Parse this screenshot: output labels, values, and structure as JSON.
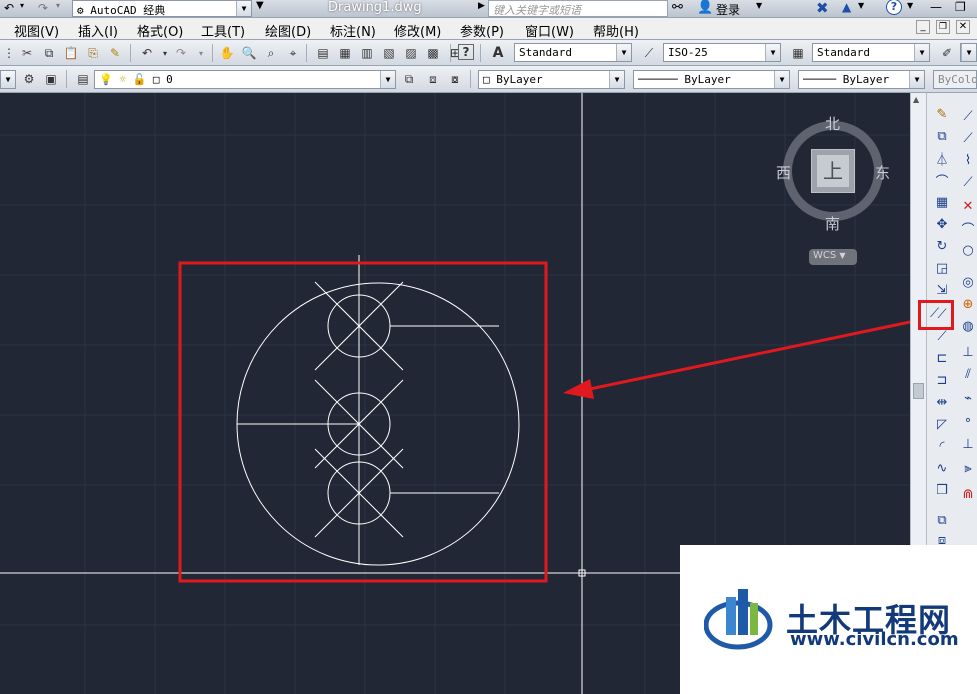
{
  "title_bar": {
    "workspace": "AutoCAD 经典",
    "document": "Drawing1.dwg",
    "search_placeholder": "键入关键字或短语",
    "login": "登录"
  },
  "menu": [
    "视图(V)",
    "插入(I)",
    "格式(O)",
    "工具(T)",
    "绘图(D)",
    "标注(N)",
    "修改(M)",
    "参数(P)",
    "窗口(W)",
    "帮助(H)"
  ],
  "styles": {
    "text_style": "Standard",
    "dim_style": "ISO-25",
    "table_style": "Standard"
  },
  "layers": {
    "current_layer": "0",
    "color": "ByLayer",
    "linetype": "ByLayer",
    "lineweight": "ByLayer",
    "plotstyle": "ByColor"
  },
  "viewcube": {
    "north": "北",
    "south": "南",
    "east": "东",
    "west": "西",
    "face": "上",
    "wcs": "WCS"
  },
  "watermark": {
    "name": "土木工程网",
    "url": "www.civilcn.com"
  },
  "colors": {
    "canvas": "#212735",
    "highlight": "#e0191e",
    "drawing_line": "#ffffff"
  }
}
